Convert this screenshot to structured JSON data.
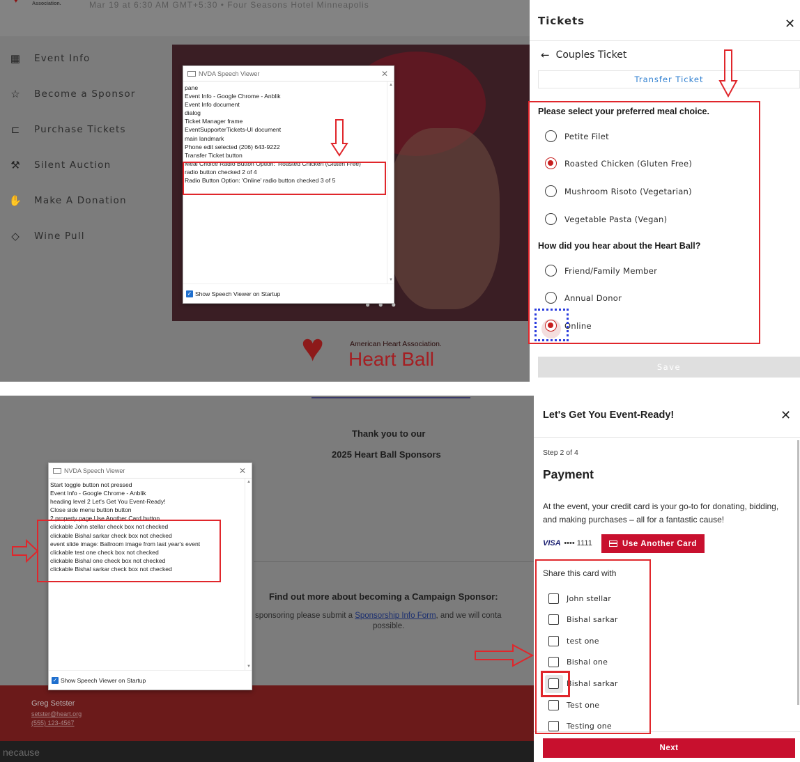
{
  "top": {
    "header_date": "Mar 19 at 6:30 AM GMT+5:30 • Four Seasons Hotel Minneapolis",
    "logo_text": "Association.",
    "nav": [
      {
        "label": "Event Info",
        "icon": "calendar-icon",
        "glyph": "▦"
      },
      {
        "label": "Become a Sponsor",
        "icon": "star-icon",
        "glyph": "☆"
      },
      {
        "label": "Purchase Tickets",
        "icon": "ticket-icon",
        "glyph": "⊏"
      },
      {
        "label": "Silent Auction",
        "icon": "gavel-icon",
        "glyph": "⚒"
      },
      {
        "label": "Make A Donation",
        "icon": "donation-hand-icon",
        "glyph": "✋"
      },
      {
        "label": "Wine Pull",
        "icon": "tag-icon",
        "glyph": "◇"
      }
    ],
    "aha_name": "American Heart Association.",
    "aha_event": "Heart Ball",
    "nvda": {
      "title": "NVDA Speech Viewer",
      "lines": [
        "pane",
        "Event Info - Google Chrome - Anblik",
        "Event Info  document",
        "dialog",
        "Ticket Manager  frame",
        "EventSupporterTickets-UI  document",
        "main landmark",
        "Phone  edit  selected (206) 643-9222",
        "Transfer Ticket  button",
        "Meal Choice Radio Button Option: 'Roasted Chicken (Gluten Free)'",
        "radio button  checked  2 of 4",
        "Radio Button Option: 'Online'  radio button  checked  3 of 5"
      ],
      "footer": "Show Speech Viewer on Startup"
    },
    "drawer": {
      "title": "Tickets",
      "back_label": "Couples Ticket",
      "transfer_label": "Transfer Ticket",
      "meal_question": "Please select your preferred meal choice.",
      "meal_options": [
        {
          "label": "Petite Filet",
          "checked": false
        },
        {
          "label": "Roasted Chicken (Gluten Free)",
          "checked": true
        },
        {
          "label": "Mushroom Risoto (Vegetarian)",
          "checked": false
        },
        {
          "label": "Vegetable Pasta (Vegan)",
          "checked": false
        }
      ],
      "hear_question": "How did you hear about the Heart Ball?",
      "hear_options": [
        {
          "label": "Friend/Family Member",
          "checked": false
        },
        {
          "label": "Annual Donor",
          "checked": false
        },
        {
          "label": "Online",
          "checked": true
        }
      ],
      "save_label": "Save"
    }
  },
  "bottom": {
    "thanks": "Thank you to our",
    "sponsors": "2025 Heart Ball Sponsors",
    "find_out": "Find out more about becoming a Campaign Sponsor:",
    "sponsoring_pre": "sponsoring please submit a ",
    "sponsoring_link": "Sponsorship Info Form",
    "sponsoring_post": ", and we will conta",
    "possible": "possible.",
    "contact_name": "Greg Setster",
    "contact_email": "setster@heart.org",
    "contact_phone": "(555) 123-4567",
    "brand": "necause",
    "nvda": {
      "title": "NVDA Speech Viewer",
      "lines": [
        "Start  toggle button  not pressed",
        "Event Info - Google Chrome - Anblik",
        "heading    level 2  Let's Get You Event-Ready!",
        "Close side menu button  button",
        "2  property page  Use Another Card  button",
        "clickable  John stellar  check box  not checked",
        "clickable  Bishal sarkar  check box  not checked",
        "event slide image: Ballroom image from last year's event",
        "clickable  test one  check box  not checked",
        "clickable  Bishal one  check box  not checked",
        "clickable  Bishal sarkar  check box  not checked"
      ],
      "footer": "Show Speech Viewer on Startup"
    },
    "drawer": {
      "title": "Let's Get You Event-Ready!",
      "step": "Step 2 of 4",
      "heading": "Payment",
      "description": "At the event, your credit card is your go-to for donating, bidding, and making purchases – all for a fantastic cause!",
      "card_brand": "VISA",
      "card_last4": "•••• 1111",
      "use_another_label": "Use Another Card",
      "share_label": "Share this card with",
      "people": [
        "John stellar",
        "Bishal sarkar",
        "test one",
        "Bishal one",
        "Bishal sarkar",
        "Test one",
        "Testing one"
      ],
      "next_label": "Next"
    }
  },
  "colors": {
    "brand_red": "#c8102e",
    "annotation_red": "#e0262b",
    "focus_blue": "#2a3cde",
    "link_blue": "#2f7fd0"
  }
}
